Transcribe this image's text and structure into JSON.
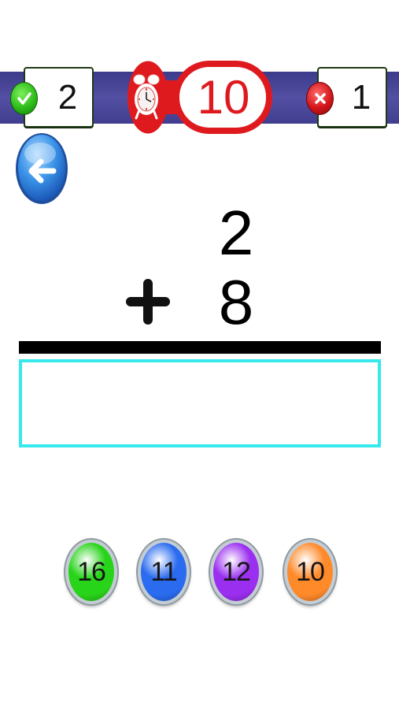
{
  "score": {
    "correct": "2",
    "wrong": "1",
    "correct_icon": "check-icon",
    "wrong_icon": "cross-icon"
  },
  "timer": {
    "value": "10",
    "icon": "alarm-clock-icon",
    "color": "#df1a1f"
  },
  "back": {
    "icon": "back-arrow-icon"
  },
  "problem": {
    "top_operand": "2",
    "bottom_operand": "8",
    "operator_icon": "plus-icon",
    "answer": ""
  },
  "choices": [
    {
      "label": "16",
      "color": "#28d41a"
    },
    {
      "label": "11",
      "color": "#2a6bf0"
    },
    {
      "label": "12",
      "color": "#9b2ff0"
    },
    {
      "label": "10",
      "color": "#ff8a2a"
    }
  ]
}
